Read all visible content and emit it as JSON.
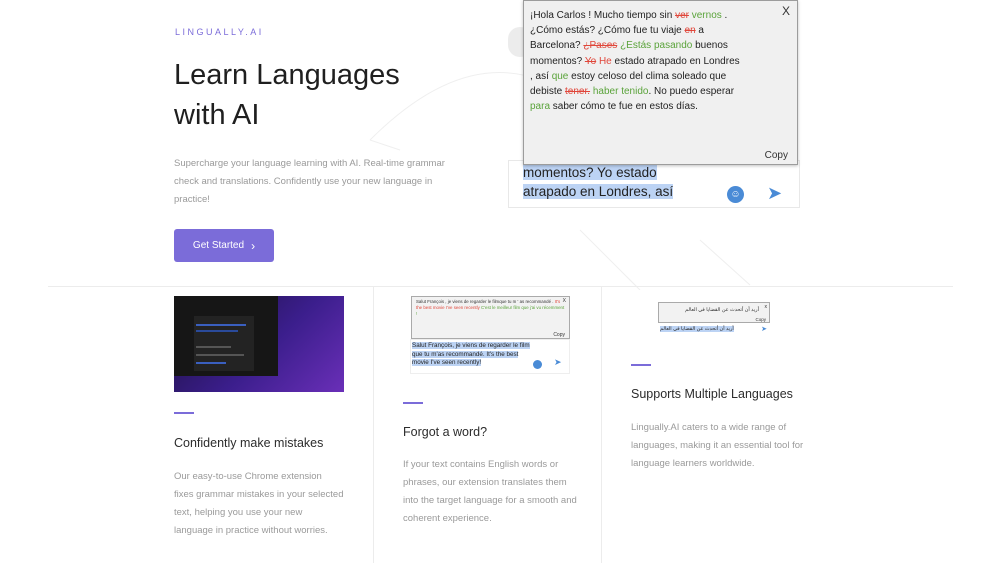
{
  "brand": "LINGUALLY.AI",
  "hero": {
    "title": "Learn Languages with AI",
    "description": "Supercharge your language learning with AI. Real-time grammar check and translations. Confidently use your new language in practice!",
    "cta_label": "Get Started",
    "cta_icon": "chevron-right-icon"
  },
  "popup": {
    "close_label": "X",
    "copy_label": "Copy",
    "segments": [
      {
        "text": "¡Hola Carlos ! Mucho tiempo sin ",
        "style": "normal"
      },
      {
        "text": "ver",
        "style": "red-s"
      },
      {
        "text": " ",
        "style": "normal"
      },
      {
        "text": "vernos",
        "style": "green"
      },
      {
        "text": " . ¿Cómo estás? ¿Cómo fue tu viaje ",
        "style": "normal"
      },
      {
        "text": "en",
        "style": "red-s"
      },
      {
        "text": " a Barcelona? ",
        "style": "normal"
      },
      {
        "text": "¿Pases",
        "style": "red-s"
      },
      {
        "text": " ",
        "style": "normal"
      },
      {
        "text": "¿Estás pasando",
        "style": "green"
      },
      {
        "text": " buenos momentos? ",
        "style": "normal"
      },
      {
        "text": "Yo",
        "style": "red-s"
      },
      {
        "text": " ",
        "style": "normal"
      },
      {
        "text": "He",
        "style": "red"
      },
      {
        "text": " estado atrapado en Londres , así ",
        "style": "normal"
      },
      {
        "text": "que",
        "style": "green"
      },
      {
        "text": " estoy celoso del clima soleado que debiste ",
        "style": "normal"
      },
      {
        "text": "tener.",
        "style": "red-s"
      },
      {
        "text": " ",
        "style": "normal"
      },
      {
        "text": "haber tenido",
        "style": "green"
      },
      {
        "text": ". No puedo esperar ",
        "style": "normal"
      },
      {
        "text": "para",
        "style": "green"
      },
      {
        "text": " saber cómo te fue en estos días.",
        "style": "normal"
      }
    ]
  },
  "compose": {
    "text": "momentos? Yo estado atrapado en Londres, así"
  },
  "features": [
    {
      "title": "Confidently make mistakes",
      "description": "Our easy-to-use Chrome extension fixes grammar mistakes in your selected text, helping you use your new language in practice without worries."
    },
    {
      "title": "Forgot a word?",
      "description": "If your text contains English words or phrases, our extension translates them into the target language for a smooth and coherent experience."
    },
    {
      "title": "Supports Multiple Languages",
      "description": "Lingually.AI caters to a wide range of languages, making it an essential tool for language learners worldwide."
    }
  ],
  "shot2": {
    "popup_lines": [
      {
        "text": "Salut François , je viens de regarder le film",
        "style": "normal"
      },
      {
        "text": "que tu m ' as recommandé . ",
        "style": "normal"
      },
      {
        "text": "It's the best movie I've seen recently",
        "style": "red"
      },
      {
        "text": " C'est le meilleur film que j'ai vu récemment !",
        "style": "green"
      }
    ],
    "close_label": "X",
    "copy_label": "Copy",
    "compose_text": "Salut François, je viens de regarder le film que tu m'as recommandé. It's the best movie I've seen recently!"
  },
  "shot3": {
    "popup_text": "أريد أن أتحدث عن القضايا في العالم",
    "copy_label": "Copy",
    "compose_text": "أريد أن أتحدث عن القضايا في العالم"
  },
  "colors": {
    "accent": "#7b6cd9",
    "correction_red": "#e0463a",
    "correction_green": "#5aa33a",
    "selection": "#bcd3f4",
    "send_blue": "#4a8bd6"
  }
}
